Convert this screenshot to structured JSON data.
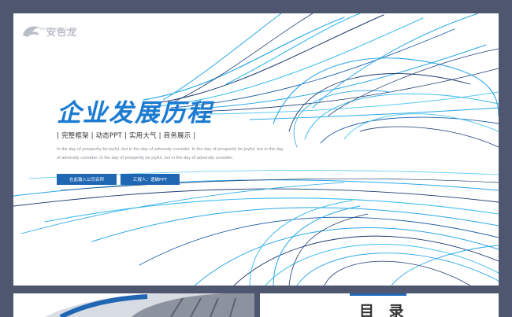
{
  "slide": {
    "logo_text": "安色龙",
    "logo_subtext": "www.anselong.com",
    "title": "企业发展历程",
    "tagline": "| 完整框架 | 动态PPT | 实用大气 | 商务展示 |",
    "body": "In the day of prosperity be joyful, but in the day of adversity consider. In the day of prosperity be joyful, but in the day of adversity consider. In the day of prosperity be joyful, but in the day of adversity consider.",
    "button_company": "在此输入公司名称",
    "button_presenter": "汇报人：语嫣PPT",
    "colors": {
      "title": "#1b7bd0",
      "button": "#1f66b3",
      "background_frame": "#4f5670",
      "line_cyan": "#29a8e8",
      "line_navy": "#1e3a6e"
    }
  },
  "next_slide": {
    "toc_title": "目 录"
  }
}
